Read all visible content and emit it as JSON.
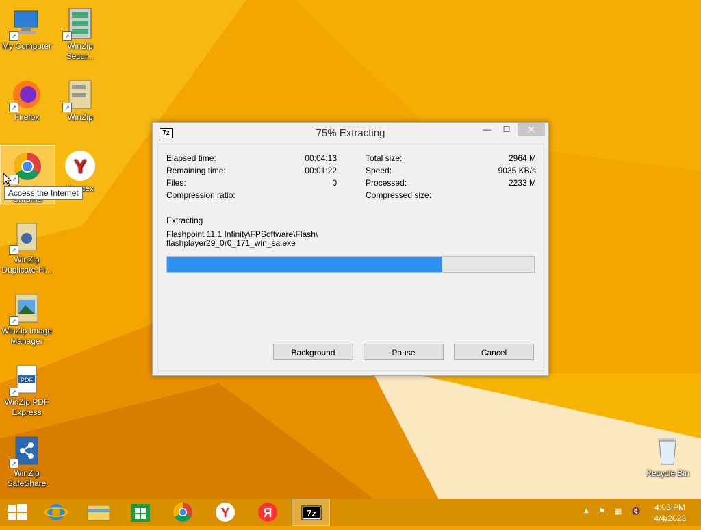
{
  "desktop": {
    "icons": [
      {
        "label": "My Computer",
        "icon": "computer-icon"
      },
      {
        "label": "WinZip Secur...",
        "icon": "winzip-secure-icon"
      },
      {
        "label": "Firefox",
        "icon": "firefox-icon"
      },
      {
        "label": "WinZip",
        "icon": "winzip-icon"
      },
      {
        "label": "Google Chrome",
        "icon": "chrome-icon"
      },
      {
        "label": "Yandex",
        "icon": "yandex-icon"
      },
      {
        "label": "WinZip Duplicate Fi...",
        "icon": "winzip-duplicate-icon"
      },
      {
        "label": "WinZip Image Manager",
        "icon": "winzip-image-icon"
      },
      {
        "label": "WinZip PDF Express",
        "icon": "pdf-icon"
      },
      {
        "label": "WinZip SafeShare",
        "icon": "share-icon"
      },
      {
        "label": "Recycle Bin",
        "icon": "recycle-bin-icon"
      }
    ],
    "tooltip": "Access the Internet"
  },
  "dialog": {
    "title": "75% Extracting",
    "app_icon": "7z",
    "buttons": {
      "minimize": "—",
      "maximize": "☐",
      "close": "✕"
    },
    "stats_left": [
      {
        "label": "Elapsed time:",
        "value": "00:04:13"
      },
      {
        "label": "Remaining time:",
        "value": "00:01:22"
      },
      {
        "label": "Files:",
        "value": "0"
      },
      {
        "label": "Compression ratio:",
        "value": ""
      }
    ],
    "stats_right": [
      {
        "label": "Total size:",
        "value": "2964 M"
      },
      {
        "label": "Speed:",
        "value": "9035 KB/s"
      },
      {
        "label": "Processed:",
        "value": "2233 M"
      },
      {
        "label": "Compressed size:",
        "value": ""
      }
    ],
    "operation": "Extracting",
    "path_line1": "Flashpoint 11.1 Infinity\\FPSoftware\\Flash\\",
    "path_line2": "flashplayer29_0r0_171_win_sa.exe",
    "progress": 0.75,
    "actions": {
      "background": "Background",
      "pause": "Pause",
      "cancel": "Cancel"
    }
  },
  "taskbar": {
    "apps": [
      "start-icon",
      "ie-icon",
      "file-explorer-icon",
      "store-icon",
      "chrome-icon",
      "yandex-browser-icon",
      "yandex-icon",
      "7zip-icon"
    ],
    "active_app": "7zip-icon",
    "clock_time": "4:03 PM",
    "clock_date": "4/4/2023"
  }
}
